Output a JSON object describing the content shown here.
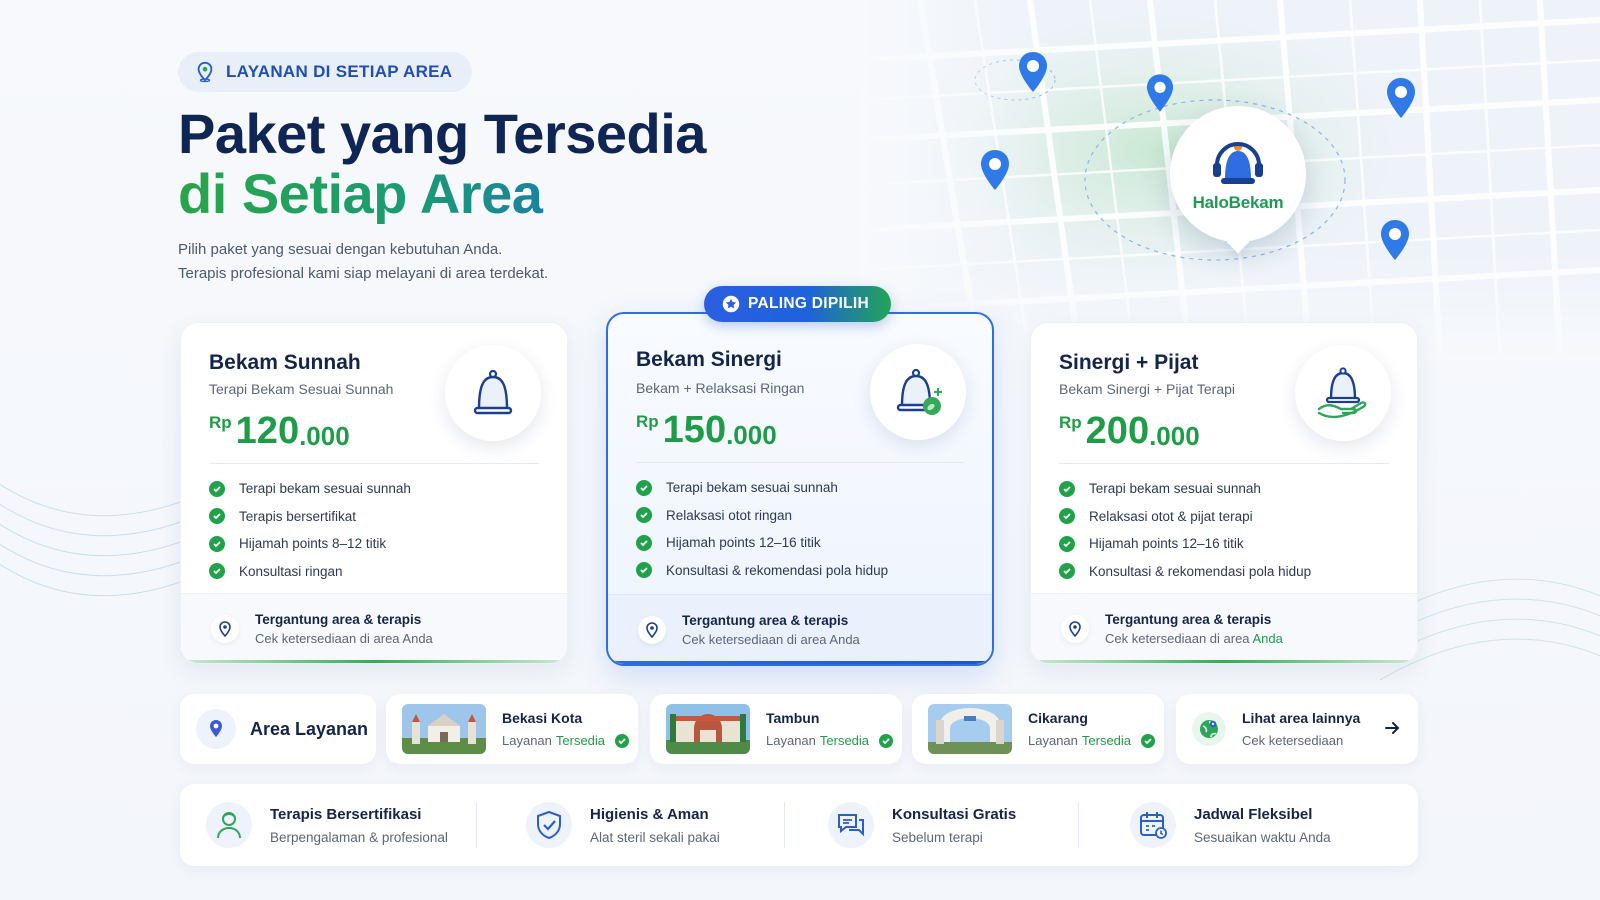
{
  "hero": {
    "badge": "LAYANAN DI SETIAP AREA",
    "title_line1": "Paket yang Tersedia",
    "title_line2": "di Setiap Area",
    "subtitle_line1": "Pilih paket yang sesuai dengan kebutuhan Anda.",
    "subtitle_line2": "Terapis profesional kami siap melayani di area terdekat."
  },
  "brand": {
    "name": "HaloBekam"
  },
  "popular_badge": "PALING DIPILIH",
  "packages": [
    {
      "name": "Bekam Sunnah",
      "desc": "Terapi Bekam Sesuai Sunnah",
      "currency": "Rp",
      "price_main": "120",
      "price_dec": ".000",
      "icon": "cupping-cup-icon",
      "features": [
        "Terapi bekam sesuai sunnah",
        "Terapis bersertifikat",
        "Hijamah points 8–12 titik",
        "Konsultasi ringan"
      ],
      "foot_title": "Tergantung area & terapis",
      "foot_sub": "Cek ketersediaan di area Anda"
    },
    {
      "name": "Bekam Sinergi",
      "desc": "Bekam + Relaksasi Ringan",
      "currency": "Rp",
      "price_main": "150",
      "price_dec": ".000",
      "icon": "cupping-cup-plus-icon",
      "features": [
        "Terapi bekam sesuai sunnah",
        "Relaksasi otot ringan",
        "Hijamah points 12–16 titik",
        "Konsultasi & rekomendasi pola hidup"
      ],
      "foot_title": "Tergantung area & terapis",
      "foot_sub": "Cek ketersediaan di area Anda"
    },
    {
      "name": "Sinergi + Pijat",
      "desc": "Bekam Sinergi + Pijat Terapi",
      "currency": "Rp",
      "price_main": "200",
      "price_dec": ".000",
      "icon": "cupping-cup-hand-icon",
      "features": [
        "Terapi bekam sesuai sunnah",
        "Relaksasi otot & pijat terapi",
        "Hijamah points 12–16 titik",
        "Konsultasi & rekomendasi pola hidup"
      ],
      "foot_title": "Tergantung area & terapis",
      "foot_sub_pre": "Cek ketersediaan di area ",
      "foot_sub_hl": "Anda"
    }
  ],
  "areas": {
    "title": "Area Layanan",
    "status_pre": "Layanan ",
    "status_hl": "Tersedia",
    "cities": [
      "Bekasi Kota",
      "Tambun",
      "Cikarang"
    ],
    "more_title": "Lihat area lainnya",
    "more_sub": "Cek ketersediaan"
  },
  "benefits": [
    {
      "title": "Terapis Bersertifikasi",
      "sub": "Berpengalaman & profesional",
      "icon": "therapist-icon"
    },
    {
      "title": "Higienis & Aman",
      "sub": "Alat steril sekali pakai",
      "icon": "shield-check-icon"
    },
    {
      "title": "Konsultasi Gratis",
      "sub": "Sebelum terapi",
      "icon": "chat-icon"
    },
    {
      "title": "Jadwal Fleksibel",
      "sub": "Sesuaikan waktu Anda",
      "icon": "calendar-icon"
    }
  ],
  "colors": {
    "navy": "#0f2554",
    "green": "#1e9c48",
    "blue": "#2f6ee0"
  }
}
